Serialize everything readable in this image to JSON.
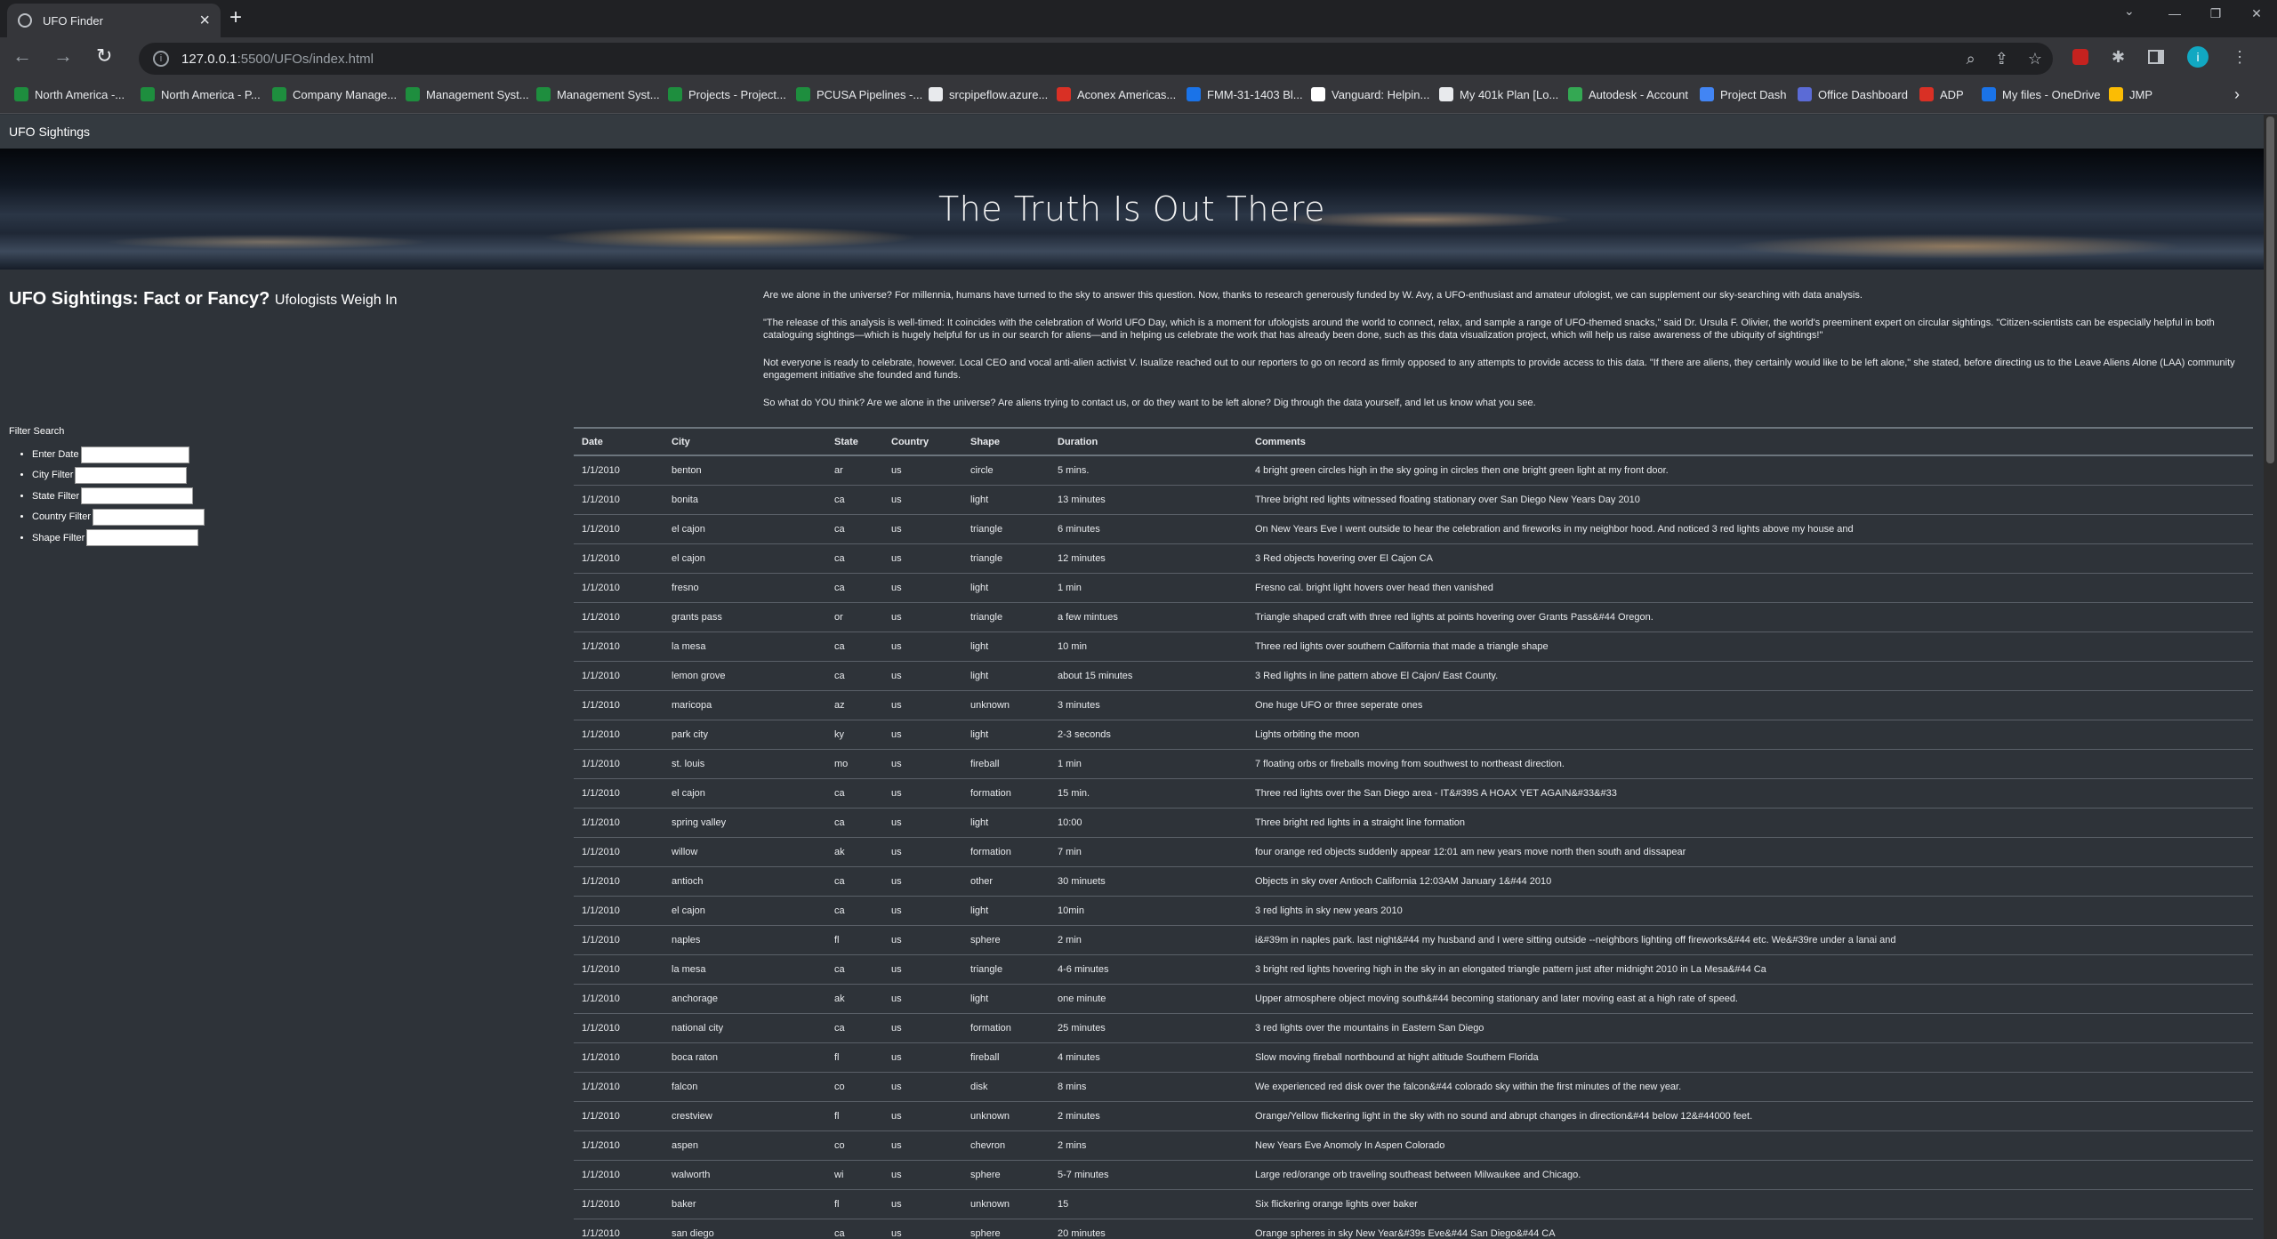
{
  "browser": {
    "tab_title": "UFO Finder",
    "url_host": "127.0.0.1",
    "url_path": ":5500/UFOs/index.html",
    "avatar_letter": "i",
    "bookmarks": [
      {
        "label": "North America -...",
        "color": "#1e8e3e"
      },
      {
        "label": "North America - P...",
        "color": "#1e8e3e"
      },
      {
        "label": "Company Manage...",
        "color": "#1e8e3e"
      },
      {
        "label": "Management Syst...",
        "color": "#1e8e3e"
      },
      {
        "label": "Management Syst...",
        "color": "#1e8e3e"
      },
      {
        "label": "Projects - Project...",
        "color": "#1e8e3e"
      },
      {
        "label": "PCUSA Pipelines -...",
        "color": "#1e8e3e"
      },
      {
        "label": "srcpipeflow.azure...",
        "color": "#e8eaed"
      },
      {
        "label": "Aconex Americas...",
        "color": "#d93025"
      },
      {
        "label": "FMM-31-1403 Bl...",
        "color": "#1a73e8"
      },
      {
        "label": "Vanguard: Helpin...",
        "color": "#ffffff"
      },
      {
        "label": "My 401k Plan [Lo...",
        "color": "#e8eaed"
      },
      {
        "label": "Autodesk - Account",
        "color": "#34a853"
      },
      {
        "label": "Project Dash",
        "color": "#4285f4"
      },
      {
        "label": "Office Dashboard",
        "color": "#5b6bd6"
      },
      {
        "label": "ADP",
        "color": "#d93025"
      },
      {
        "label": "My files - OneDrive",
        "color": "#1a73e8"
      },
      {
        "label": "JMP",
        "color": "#fbbc04"
      }
    ]
  },
  "page": {
    "brand": "UFO Sightings",
    "jumbotron_title": "The Truth Is Out There",
    "heading": "UFO Sightings: Fact or Fancy?",
    "heading_small": "Ufologists Weigh In",
    "paragraphs": [
      "Are we alone in the universe? For millennia, humans have turned to the sky to answer this question. Now, thanks to research generously funded by W. Avy, a UFO-enthusiast and amateur ufologist, we can supplement our sky-searching with data analysis.",
      "\"The release of this analysis is well-timed: It coincides with the celebration of World UFO Day, which is a moment for ufologists around the world to connect, relax, and sample a range of UFO-themed snacks,\" said Dr. Ursula F. Olivier, the world's preeminent expert on circular sightings. \"Citizen-scientists can be especially helpful in both cataloguing sightings—which is hugely helpful for us in our search for aliens—and in helping us celebrate the work that has already been done, such as this data visualization project, which will help us raise awareness of the ubiquity of sightings!\"",
      "Not everyone is ready to celebrate, however. Local CEO and vocal anti-alien activist V. Isualize reached out to our reporters to go on record as firmly opposed to any attempts to provide access to this data. \"If there are aliens, they certainly would like to be left alone,\" she stated, before directing us to the Leave Aliens Alone (LAA) community engagement initiative she founded and funds.",
      "So what do YOU think? Are we alone in the universe? Are aliens trying to contact us, or do they want to be left alone? Dig through the data yourself, and let us know what you see."
    ],
    "filter_title": "Filter Search",
    "filters": [
      {
        "label": "Enter Date",
        "name": "date-filter-input",
        "width": 122
      },
      {
        "label": "City Filter",
        "name": "city-filter-input",
        "width": 126
      },
      {
        "label": "State Filter",
        "name": "state-filter-input",
        "width": 126
      },
      {
        "label": "Country Filter",
        "name": "country-filter-input",
        "width": 126
      },
      {
        "label": "Shape Filter",
        "name": "shape-filter-input",
        "width": 126
      }
    ],
    "table": {
      "headers": [
        "Date",
        "City",
        "State",
        "Country",
        "Shape",
        "Duration",
        "Comments"
      ],
      "rows": [
        [
          "1/1/2010",
          "benton",
          "ar",
          "us",
          "circle",
          "5 mins.",
          "4 bright green circles high in the sky going in circles then one bright green light at my front door."
        ],
        [
          "1/1/2010",
          "bonita",
          "ca",
          "us",
          "light",
          "13 minutes",
          "Three bright red lights witnessed floating stationary over San Diego New Years Day 2010"
        ],
        [
          "1/1/2010",
          "el cajon",
          "ca",
          "us",
          "triangle",
          "6 minutes",
          "On New Years Eve I went outside to hear the celebration and fireworks in my neighbor hood. And noticed 3 red lights above my house and"
        ],
        [
          "1/1/2010",
          "el cajon",
          "ca",
          "us",
          "triangle",
          "12 minutes",
          "3 Red objects hovering over El Cajon CA"
        ],
        [
          "1/1/2010",
          "fresno",
          "ca",
          "us",
          "light",
          "1 min",
          "Fresno cal. bright light hovers over head then vanished"
        ],
        [
          "1/1/2010",
          "grants pass",
          "or",
          "us",
          "triangle",
          "a few mintues",
          "Triangle shaped craft with three red lights at points hovering over Grants Pass&#44 Oregon."
        ],
        [
          "1/1/2010",
          "la mesa",
          "ca",
          "us",
          "light",
          "10 min",
          "Three red lights over southern California that made a triangle shape"
        ],
        [
          "1/1/2010",
          "lemon grove",
          "ca",
          "us",
          "light",
          "about 15 minutes",
          "3 Red lights in line pattern above El Cajon/ East County."
        ],
        [
          "1/1/2010",
          "maricopa",
          "az",
          "us",
          "unknown",
          "3 minutes",
          "One huge UFO or three seperate ones"
        ],
        [
          "1/1/2010",
          "park city",
          "ky",
          "us",
          "light",
          "2-3 seconds",
          "Lights orbiting the moon"
        ],
        [
          "1/1/2010",
          "st. louis",
          "mo",
          "us",
          "fireball",
          "1 min",
          "7 floating orbs or fireballs moving from southwest to northeast direction."
        ],
        [
          "1/1/2010",
          "el cajon",
          "ca",
          "us",
          "formation",
          "15 min.",
          "Three red lights over the San Diego area - IT&#39S A HOAX YET AGAIN&#33&#33"
        ],
        [
          "1/1/2010",
          "spring valley",
          "ca",
          "us",
          "light",
          "10:00",
          "Three bright red lights in a straight line formation"
        ],
        [
          "1/1/2010",
          "willow",
          "ak",
          "us",
          "formation",
          "7 min",
          "four orange red objects suddenly appear 12:01 am new years move north then south and dissapear"
        ],
        [
          "1/1/2010",
          "antioch",
          "ca",
          "us",
          "other",
          "30 minuets",
          "Objects in sky over Antioch California 12:03AM January 1&#44 2010"
        ],
        [
          "1/1/2010",
          "el cajon",
          "ca",
          "us",
          "light",
          "10min",
          "3 red lights in sky new years 2010"
        ],
        [
          "1/1/2010",
          "naples",
          "fl",
          "us",
          "sphere",
          "2 min",
          "i&#39m in naples park. last night&#44 my husband and I were sitting outside --neighbors lighting off fireworks&#44 etc. We&#39re under a lanai and"
        ],
        [
          "1/1/2010",
          "la mesa",
          "ca",
          "us",
          "triangle",
          "4-6 minutes",
          "3 bright red lights hovering high in the sky in an elongated triangle pattern just after midnight 2010 in La Mesa&#44 Ca"
        ],
        [
          "1/1/2010",
          "anchorage",
          "ak",
          "us",
          "light",
          "one minute",
          "Upper atmosphere object moving south&#44 becoming stationary and later moving east at a high rate of speed."
        ],
        [
          "1/1/2010",
          "national city",
          "ca",
          "us",
          "formation",
          "25 minutes",
          "3 red lights over the mountains in Eastern San Diego"
        ],
        [
          "1/1/2010",
          "boca raton",
          "fl",
          "us",
          "fireball",
          "4 minutes",
          "Slow moving fireball northbound at hight altitude Southern Florida"
        ],
        [
          "1/1/2010",
          "falcon",
          "co",
          "us",
          "disk",
          "8 mins",
          "We experienced red disk over the falcon&#44 colorado sky within the first minutes of the new year."
        ],
        [
          "1/1/2010",
          "crestview",
          "fl",
          "us",
          "unknown",
          "2 minutes",
          "Orange/Yellow flickering light in the sky with no sound and abrupt changes in direction&#44 below 12&#44000 feet."
        ],
        [
          "1/1/2010",
          "aspen",
          "co",
          "us",
          "chevron",
          "2 mins",
          "New Years Eve Anomoly In Aspen Colorado"
        ],
        [
          "1/1/2010",
          "walworth",
          "wi",
          "us",
          "sphere",
          "5-7 minutes",
          "Large red/orange orb traveling southeast between Milwaukee and Chicago."
        ],
        [
          "1/1/2010",
          "baker",
          "fl",
          "us",
          "unknown",
          "15",
          "Six flickering orange lights over baker"
        ],
        [
          "1/1/2010",
          "san diego",
          "ca",
          "us",
          "sphere",
          "20 minutes",
          "Orange spheres in sky New Year&#39s Eve&#44 San Diego&#44 CA"
        ]
      ]
    }
  }
}
